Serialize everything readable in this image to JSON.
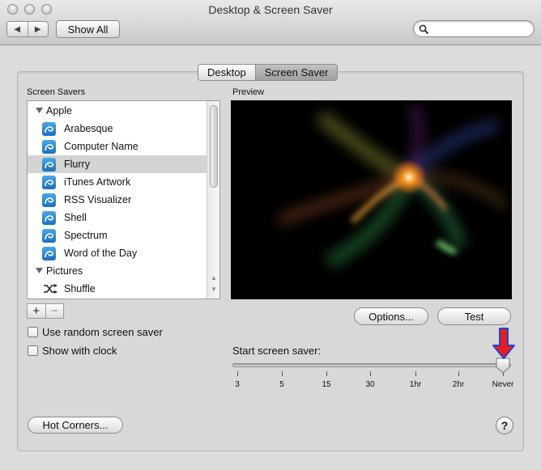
{
  "window": {
    "title": "Desktop & Screen Saver"
  },
  "toolbar": {
    "show_all_label": "Show All",
    "back_glyph": "◀",
    "forward_glyph": "▶",
    "search_placeholder": ""
  },
  "tabs": [
    {
      "label": "Desktop",
      "active": false
    },
    {
      "label": "Screen Saver",
      "active": true
    }
  ],
  "screen_savers": {
    "label": "Screen Savers",
    "items": [
      {
        "label": "Apple",
        "type": "group"
      },
      {
        "label": "Arabesque",
        "type": "saver"
      },
      {
        "label": "Computer Name",
        "type": "saver"
      },
      {
        "label": "Flurry",
        "type": "saver",
        "selected": true
      },
      {
        "label": "iTunes Artwork",
        "type": "saver"
      },
      {
        "label": "RSS Visualizer",
        "type": "saver"
      },
      {
        "label": "Shell",
        "type": "saver"
      },
      {
        "label": "Spectrum",
        "type": "saver"
      },
      {
        "label": "Word of the Day",
        "type": "saver"
      },
      {
        "label": "Pictures",
        "type": "group"
      },
      {
        "label": "Shuffle",
        "type": "shuffle"
      }
    ],
    "add_glyph": "+",
    "remove_glyph": "−"
  },
  "options": {
    "use_random_label": "Use random screen saver",
    "use_random_checked": false,
    "show_clock_label": "Show with clock",
    "show_clock_checked": false
  },
  "preview": {
    "label": "Preview",
    "options_button": "Options...",
    "test_button": "Test"
  },
  "start_screen_saver": {
    "label": "Start screen saver:",
    "ticks": [
      "3",
      "5",
      "15",
      "30",
      "1hr",
      "2hr",
      "Never"
    ],
    "selected": "Never"
  },
  "hot_corners_label": "Hot Corners...",
  "help_glyph": "?",
  "colors": {
    "annotation_arrow": "#e02020",
    "annotation_arrow_outline": "#2a3fcf",
    "preview_bg": "#000000"
  }
}
